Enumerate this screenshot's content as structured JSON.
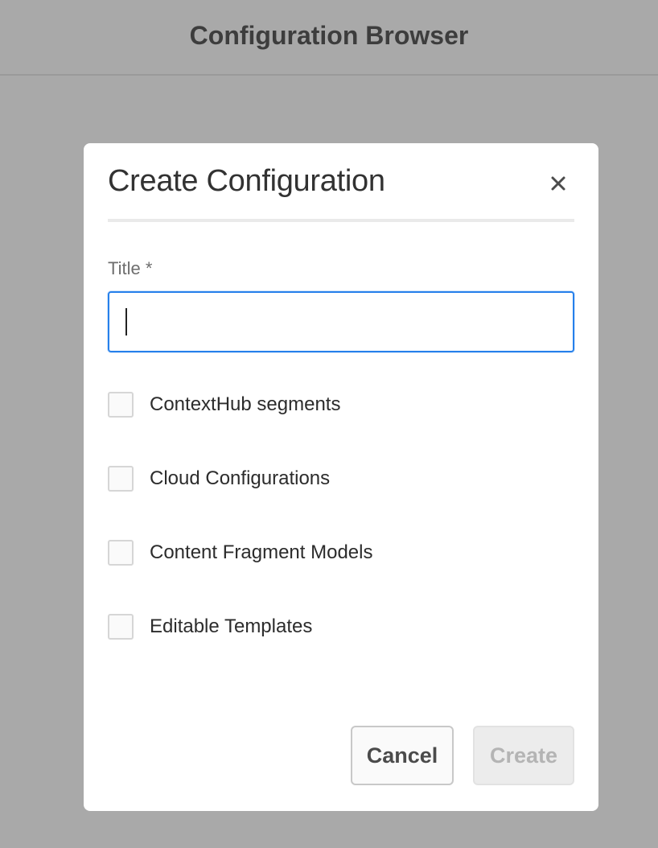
{
  "app": {
    "title": "Configuration Browser"
  },
  "dialog": {
    "title": "Create Configuration",
    "close_icon": "close-icon",
    "title_field": {
      "label": "Title *",
      "value": "",
      "placeholder": ""
    },
    "checkboxes": [
      {
        "label": "ContextHub segments",
        "checked": false
      },
      {
        "label": "Cloud Configurations",
        "checked": false
      },
      {
        "label": "Content Fragment Models",
        "checked": false
      },
      {
        "label": "Editable Templates",
        "checked": false
      }
    ],
    "buttons": {
      "cancel_label": "Cancel",
      "create_label": "Create",
      "create_disabled": true
    }
  },
  "colors": {
    "overlay": "#a9a9a9",
    "focus_border": "#2680eb"
  }
}
